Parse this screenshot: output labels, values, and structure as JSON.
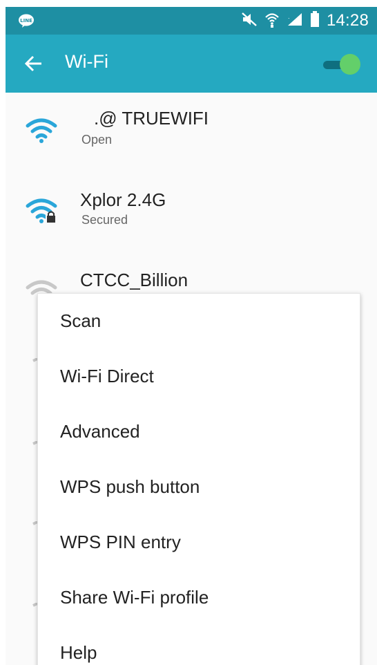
{
  "status_bar": {
    "time": "14:28",
    "icons": [
      "line-icon",
      "mute-icon",
      "wifi-status-icon",
      "signal-icon",
      "battery-icon"
    ]
  },
  "app_bar": {
    "title": "Wi-Fi",
    "back_icon": "arrow-left-icon",
    "toggle_state": "on"
  },
  "networks": [
    {
      "name": ".@ TRUEWIFI",
      "status": "Open",
      "secured": false,
      "signal": "strong"
    },
    {
      "name": "Xplor 2.4G",
      "status": "Secured",
      "secured": true,
      "signal": "strong"
    },
    {
      "name": "CTCC_Billion",
      "status": "",
      "secured": true,
      "signal": "weak"
    }
  ],
  "menu": {
    "items": [
      "Scan",
      "Wi-Fi Direct",
      "Advanced",
      "WPS push button",
      "WPS PIN entry",
      "Share Wi-Fi profile",
      "Help"
    ]
  },
  "colors": {
    "status_bar": "#1e8fa3",
    "app_bar": "#25a9c1",
    "wifi_strong": "#2aa6d9",
    "toggle_on": "#63cf6a"
  }
}
